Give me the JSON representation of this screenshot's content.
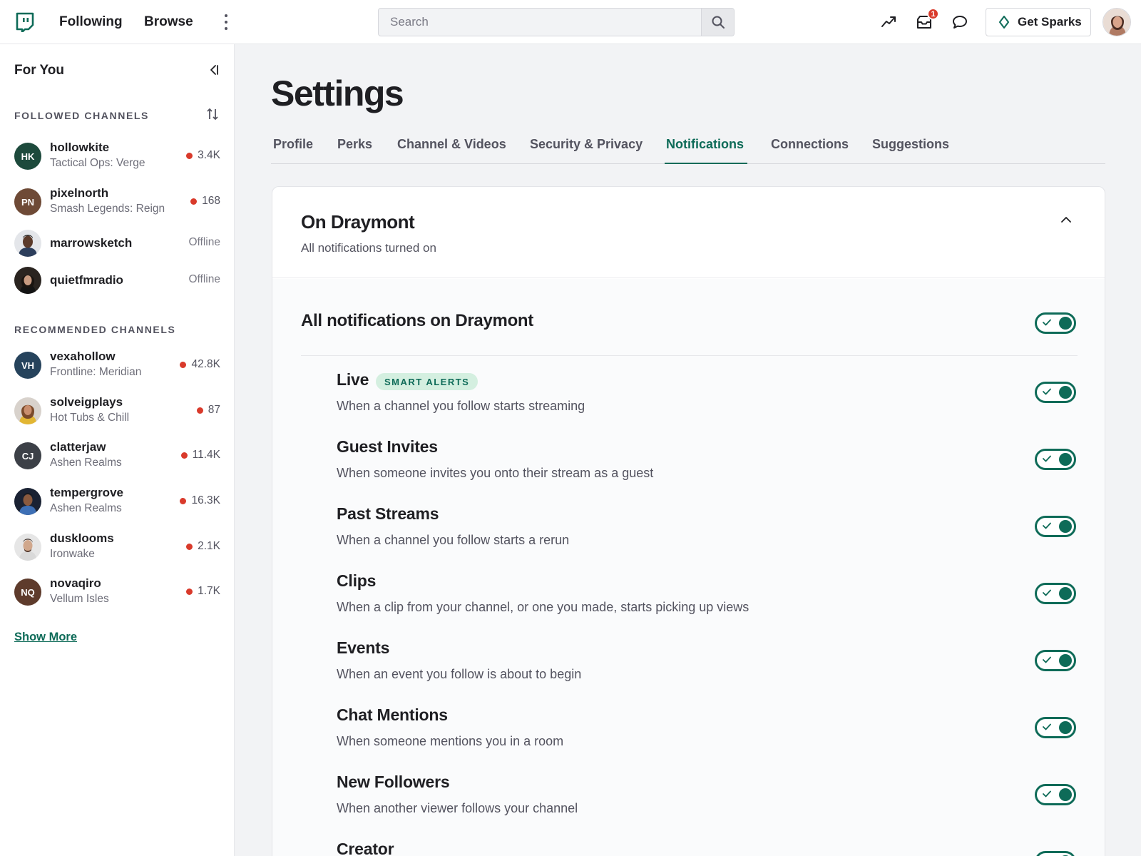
{
  "topbar": {
    "nav": [
      "Following",
      "Browse"
    ],
    "search_placeholder": "Search",
    "inbox_badge": "1",
    "sparks_label": "Get Sparks"
  },
  "sidebar": {
    "title": "For You",
    "followed_heading": "FOLLOWED CHANNELS",
    "followed": [
      {
        "initials": "HK",
        "name": "hollowkite",
        "game": "Tactical Ops: Verge",
        "count": "3.4K",
        "color": "#1d4a3c"
      },
      {
        "initials": "PN",
        "name": "pixelnorth",
        "game": "Smash Legends: Reign",
        "count": "168",
        "color": "#6e4a36"
      },
      {
        "name": "marrowsketch",
        "status": "Offline"
      },
      {
        "name": "quietfmradio",
        "status": "Offline"
      }
    ],
    "recommended_heading": "RECOMMENDED CHANNELS",
    "recommended": [
      {
        "initials": "VH",
        "name": "vexahollow",
        "game": "Frontline: Meridian",
        "count": "42.8K",
        "color": "#26435c"
      },
      {
        "name": "solveigplays",
        "game": "Hot Tubs & Chill",
        "count": "87"
      },
      {
        "initials": "CJ",
        "name": "clatterjaw",
        "game": "Ashen Realms",
        "count": "11.4K",
        "color": "#3c4047"
      },
      {
        "name": "tempergrove",
        "game": "Ashen Realms",
        "count": "16.3K"
      },
      {
        "name": "dusklooms",
        "game": "Ironwake",
        "count": "2.1K"
      },
      {
        "initials": "NQ",
        "name": "novaqiro",
        "game": "Vellum Isles",
        "count": "1.7K",
        "color": "#5e3b2c"
      }
    ],
    "show_more": "Show More"
  },
  "main": {
    "title": "Settings",
    "tabs": [
      "Profile",
      "Perks",
      "Channel & Videos",
      "Security & Privacy",
      "Notifications",
      "Connections",
      "Suggestions"
    ],
    "active_tab": "Notifications",
    "card": {
      "title": "On Draymont",
      "subtitle": "All notifications turned on",
      "master_label": "All notifications on Draymont",
      "smart_alerts_pill": "SMART ALERTS",
      "items": [
        {
          "title": "Live",
          "desc": "When a channel you follow starts streaming",
          "on": true
        },
        {
          "title": "Guest Invites",
          "desc": "When someone invites you onto their stream as a guest",
          "on": true
        },
        {
          "title": "Past Streams",
          "desc": "When a channel you follow starts a rerun",
          "on": true
        },
        {
          "title": "Clips",
          "desc": "When a clip from your channel, or one you made, starts picking up views",
          "on": true
        },
        {
          "title": "Events",
          "desc": "When an event you follow is about to begin",
          "on": true
        },
        {
          "title": "Chat Mentions",
          "desc": "When someone mentions you in a room",
          "on": true
        },
        {
          "title": "New Followers",
          "desc": "When another viewer follows your channel",
          "on": true
        },
        {
          "title": "Creator",
          "desc": "",
          "on": true
        }
      ]
    }
  },
  "colors": {
    "accent": "#0e6b58",
    "live": "#d93a2b"
  }
}
